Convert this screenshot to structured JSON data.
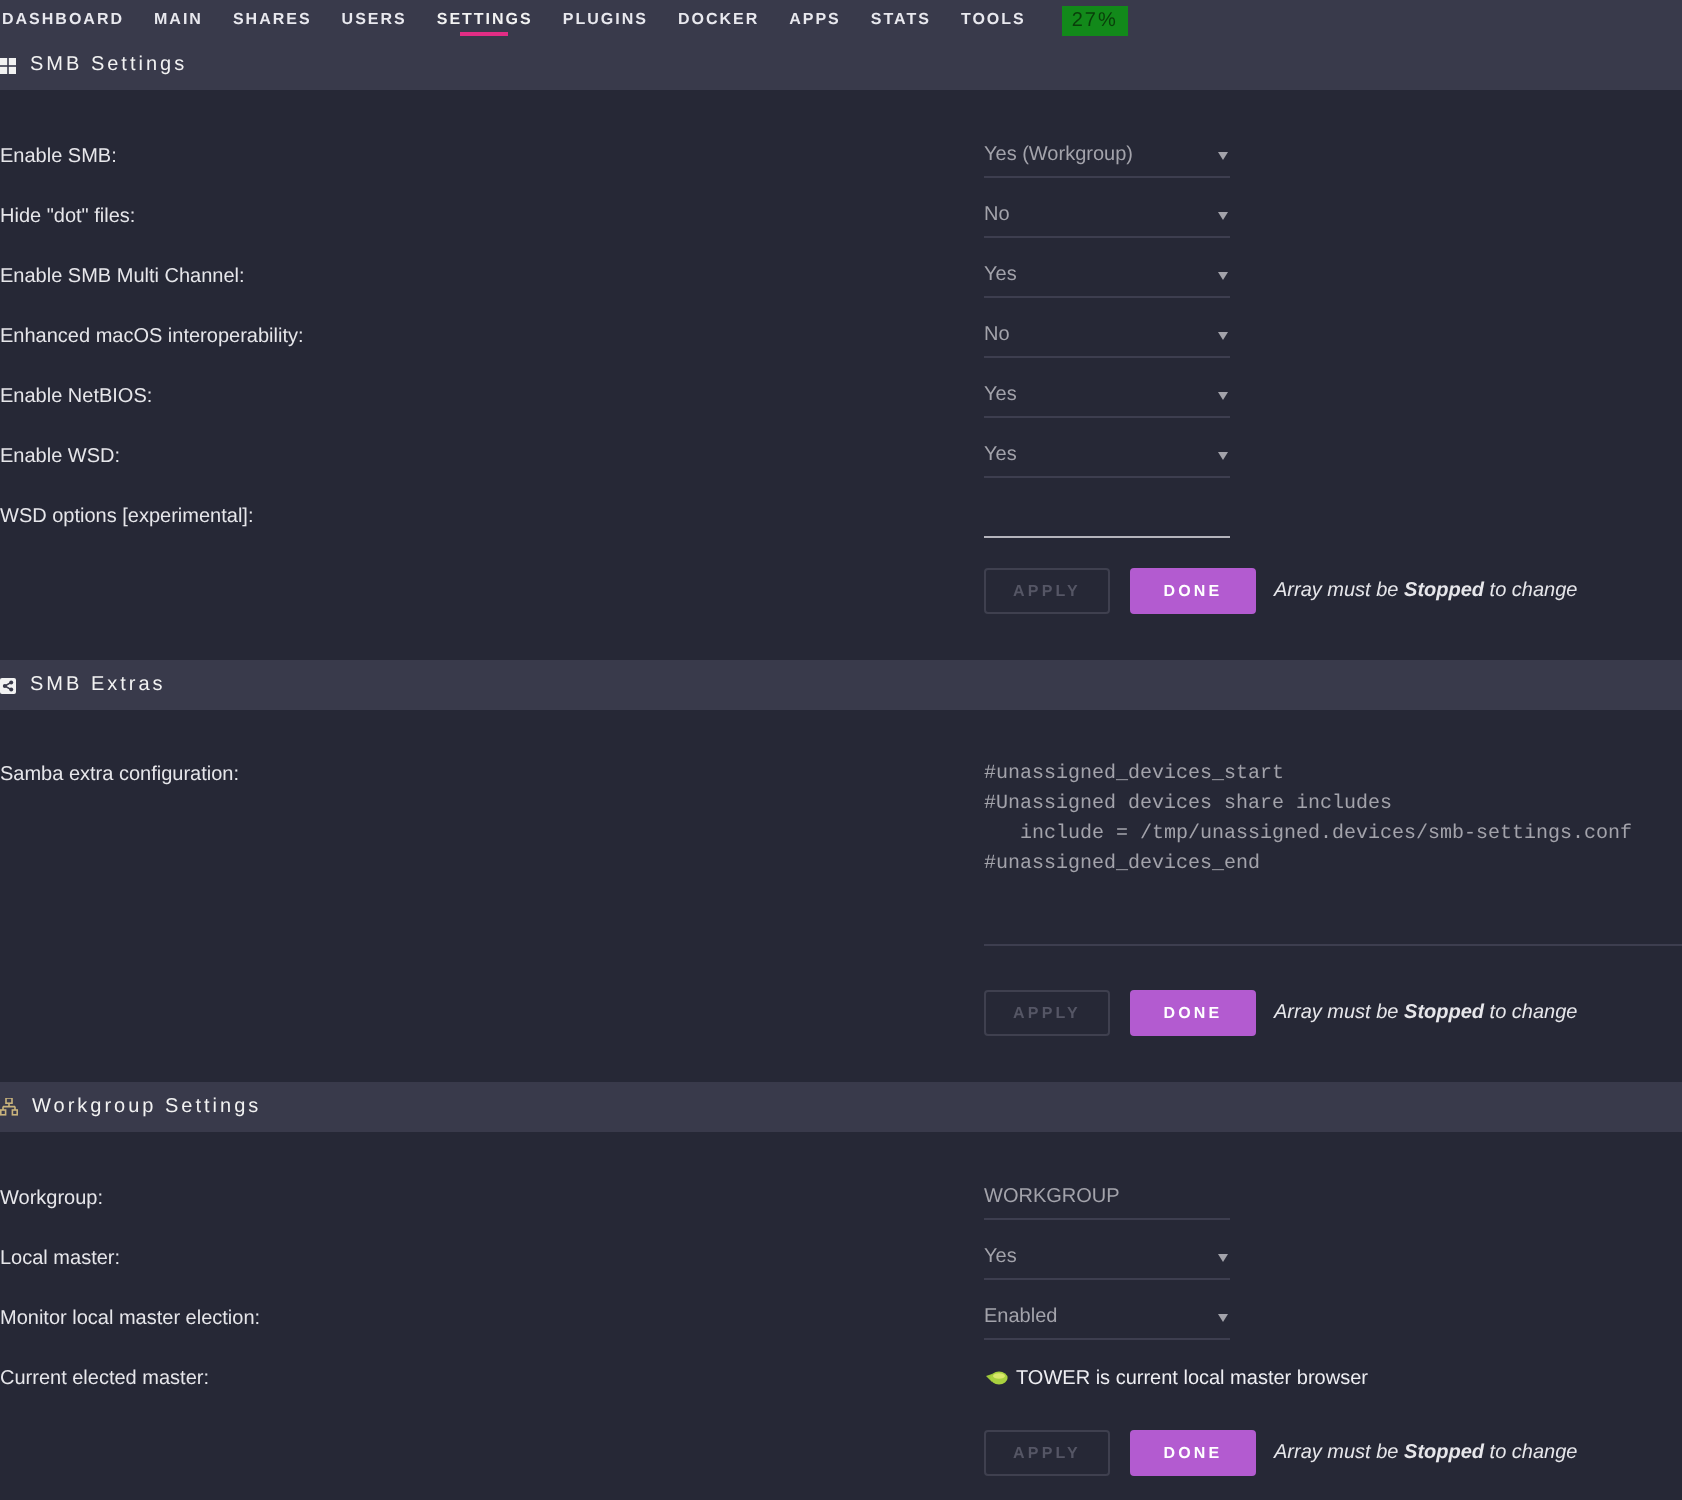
{
  "nav": {
    "items": [
      {
        "label": "DASHBOARD",
        "selected": false
      },
      {
        "label": "MAIN",
        "selected": false
      },
      {
        "label": "SHARES",
        "selected": false
      },
      {
        "label": "USERS",
        "selected": false
      },
      {
        "label": "SETTINGS",
        "selected": true
      },
      {
        "label": "PLUGINS",
        "selected": false
      },
      {
        "label": "DOCKER",
        "selected": false
      },
      {
        "label": "APPS",
        "selected": false
      },
      {
        "label": "STATS",
        "selected": false
      },
      {
        "label": "TOOLS",
        "selected": false
      }
    ],
    "badge": "27%"
  },
  "sections": [
    {
      "title": "SMB Settings",
      "fields": [
        {
          "label": "Enable SMB:",
          "kind": "select",
          "value": "Yes (Workgroup)"
        },
        {
          "label": "Hide \"dot\" files:",
          "kind": "select",
          "value": "No"
        },
        {
          "label": "Enable SMB Multi Channel:",
          "kind": "select",
          "value": "Yes"
        },
        {
          "label": "Enhanced macOS interoperability:",
          "kind": "select",
          "value": "No"
        },
        {
          "label": "Enable NetBIOS:",
          "kind": "select",
          "value": "Yes"
        },
        {
          "label": "Enable WSD:",
          "kind": "select",
          "value": "Yes"
        },
        {
          "label": "WSD options [experimental]:",
          "kind": "input",
          "focused": true
        }
      ],
      "buttons": [
        {
          "label": "APPLY",
          "disabled": true
        },
        {
          "label": "DONE",
          "disabled": false
        }
      ],
      "note": "Array must be **Stopped** to change"
    },
    {
      "title": "SMB Extras",
      "fields": [
        {
          "label": "Samba extra configuration:",
          "kind": "textarea",
          "value": "#unassigned_devices_start\n#Unassigned devices share includes\n   include = /tmp/unassigned.devices/smb-settings.conf\n#unassigned_devices_end"
        }
      ],
      "buttons": [
        {
          "label": "APPLY",
          "disabled": true
        },
        {
          "label": "DONE",
          "disabled": false
        }
      ],
      "note": "Array must be **Stopped** to change"
    },
    {
      "title": "Workgroup Settings",
      "fields": [
        {
          "label": "Workgroup:",
          "kind": "input",
          "value": "WORKGROUP",
          "focused": false
        },
        {
          "label": "Local master:",
          "kind": "select",
          "value": "Yes"
        },
        {
          "label": "Monitor local master election:",
          "kind": "select",
          "value": "Enabled"
        },
        {
          "label": "Current elected master:",
          "kind": "status",
          "value": "TOWER is current local master browser"
        }
      ],
      "buttons": [
        {
          "label": "APPLY",
          "disabled": true
        },
        {
          "label": "DONE",
          "disabled": false
        }
      ],
      "note": "Array must be **Stopped** to change"
    }
  ]
}
